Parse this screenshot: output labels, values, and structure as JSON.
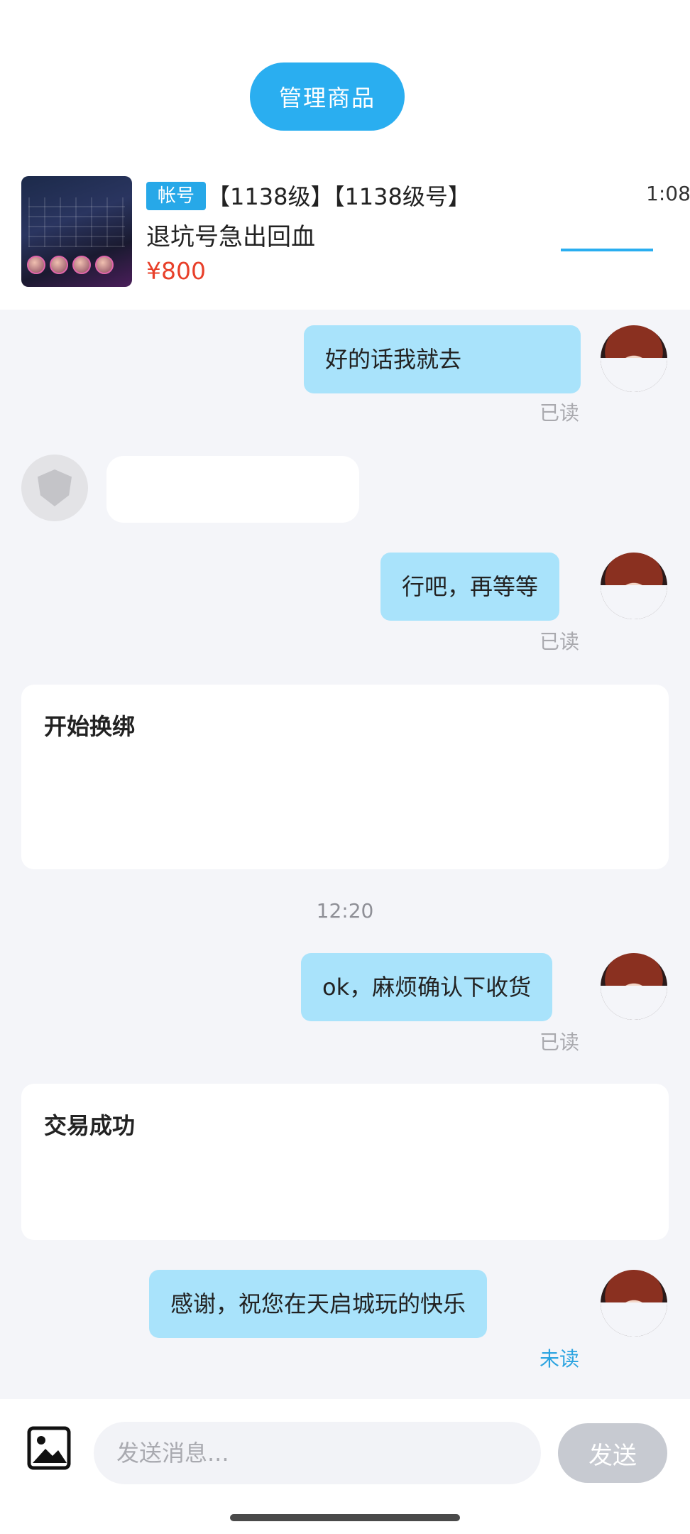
{
  "header": {
    "manage_button": "管理商品",
    "product": {
      "tag": "帐号",
      "tag_extra": "【1138级】【1138级号】",
      "tag_right": "1:08",
      "title": "退坑号急出回血",
      "price": "¥800"
    }
  },
  "messages": {
    "m1": {
      "text": "好的话我就去",
      "status": "已读"
    },
    "m2": {
      "text": "行吧，再等等",
      "status": "已读"
    },
    "card1": {
      "title": "开始换绑"
    },
    "timestamp": "12:20",
    "m3": {
      "text": "ok，麻烦确认下收货",
      "status": "已读"
    },
    "card2": {
      "title": "交易成功"
    },
    "m4": {
      "text": "感谢，祝您在天启城玩的快乐",
      "status": "未读"
    }
  },
  "input_bar": {
    "placeholder": "发送消息...",
    "send_label": "发送"
  },
  "colors": {
    "accent": "#2aaef0",
    "bubble": "#a9e3fb",
    "price": "#e8402a",
    "unread": "#2aa3e0"
  }
}
